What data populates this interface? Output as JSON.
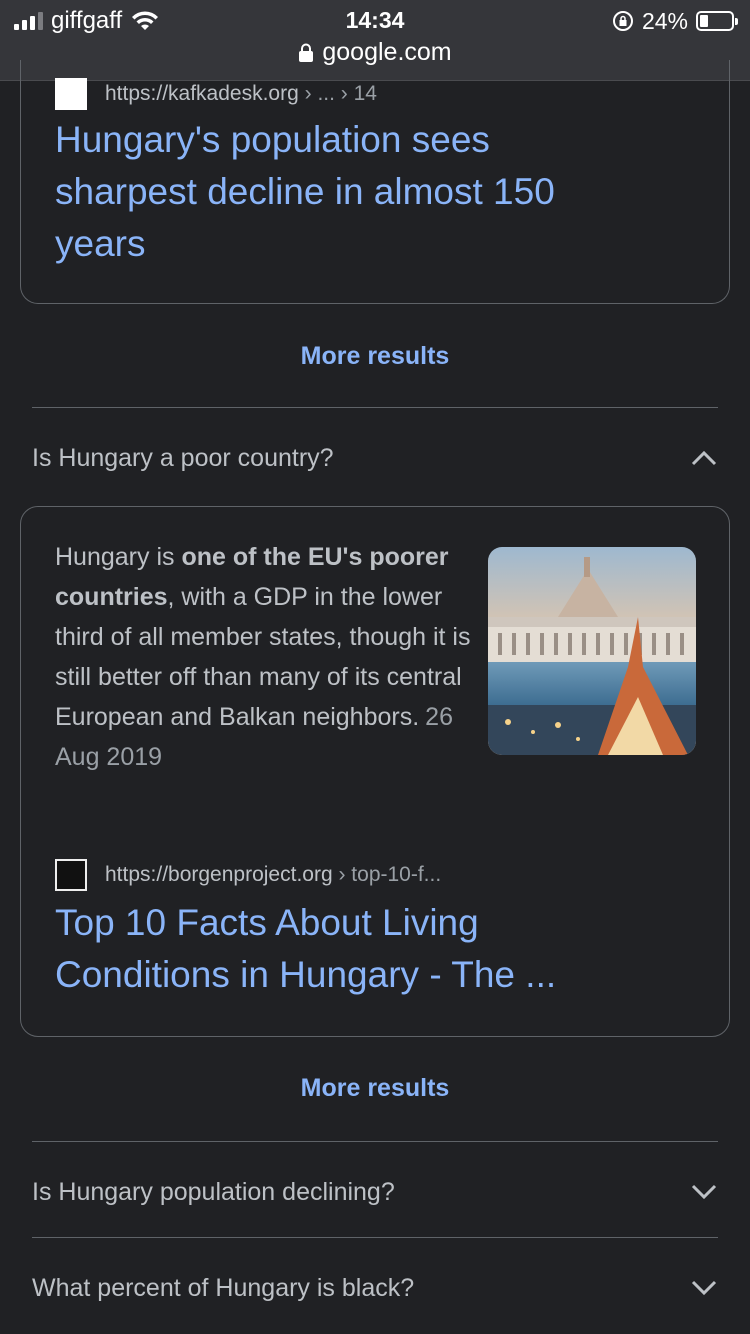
{
  "status_bar": {
    "carrier": "giffgaff",
    "time": "14:34",
    "battery": "24%",
    "battery_level": 0.24,
    "url": "google.com"
  },
  "result1": {
    "site": "https://kafkadesk.org",
    "crumb": "› ... › 14",
    "title_line1": "Hungary's population sees",
    "title_line2": "sharpest decline in almost 150",
    "title_line3": "years"
  },
  "more_results_1": "More results",
  "question_poor": "Is Hungary a poor country?",
  "answer": {
    "t1": "Hungary is ",
    "b1": "one of the EU's poorer countries",
    "t2": ", with a GDP in the lower third of all member states, though it is still better off than many of its central European and Balkan neighbors.",
    "date": "26 Aug 2019"
  },
  "result2": {
    "site": "https://borgenproject.org",
    "crumb": "› top-10-f...",
    "title_line1": "Top 10 Facts About Living",
    "title_line2": "Conditions in Hungary - The ..."
  },
  "more_results_2": "More results",
  "question_declining": "Is Hungary population declining?",
  "question_black": "What percent of Hungary is black?"
}
